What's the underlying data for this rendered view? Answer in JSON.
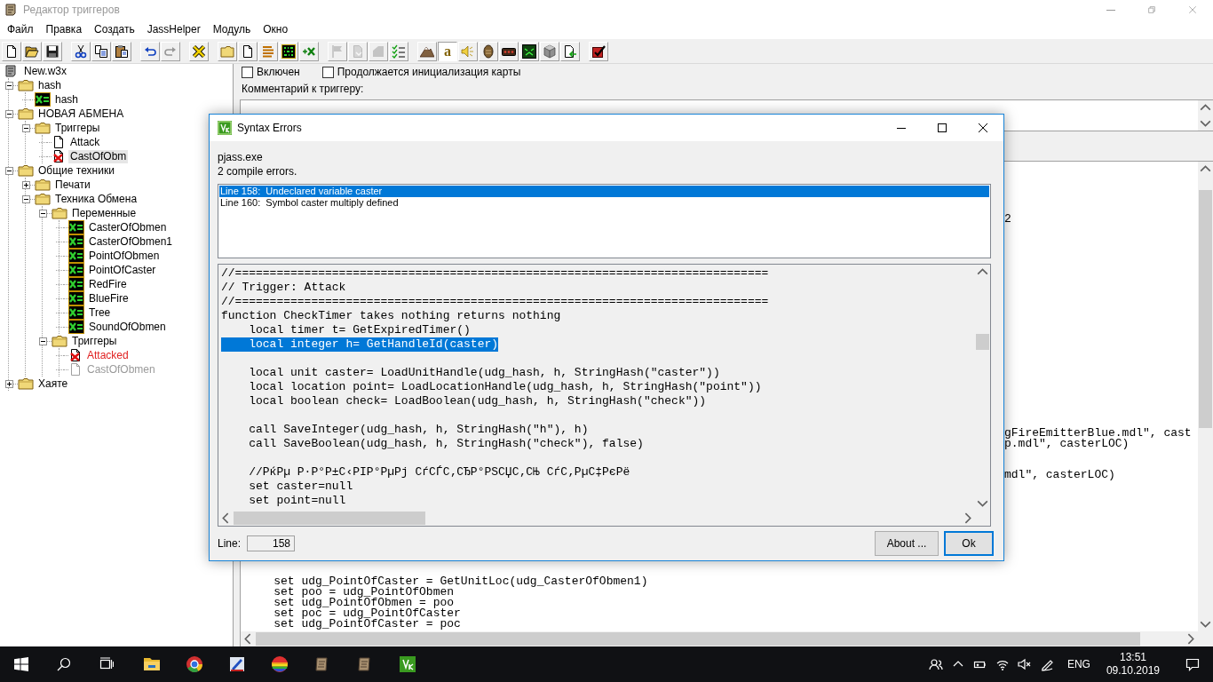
{
  "window": {
    "title": "Редактор триггеров"
  },
  "menu": [
    "Файл",
    "Правка",
    "Создать",
    "JassHelper",
    "Модуль",
    "Окно"
  ],
  "toolbar": [
    [
      {
        "kind": "new",
        "disabled": false,
        "selected": false
      },
      {
        "kind": "open",
        "disabled": false,
        "selected": false
      },
      {
        "kind": "save",
        "disabled": false,
        "selected": false
      }
    ],
    [
      {
        "kind": "cut",
        "disabled": false,
        "selected": false
      },
      {
        "kind": "copy",
        "disabled": false,
        "selected": false
      },
      {
        "kind": "paste",
        "disabled": false,
        "selected": false
      }
    ],
    [
      {
        "kind": "undo",
        "disabled": false,
        "selected": false
      },
      {
        "kind": "redo",
        "disabled": true,
        "selected": false
      }
    ],
    [
      {
        "kind": "delete",
        "disabled": false,
        "selected": false
      }
    ],
    [
      {
        "kind": "category",
        "disabled": false,
        "selected": false
      },
      {
        "kind": "trigger",
        "disabled": false,
        "selected": false
      },
      {
        "kind": "comment",
        "disabled": false,
        "selected": false
      },
      {
        "kind": "variables",
        "disabled": false,
        "selected": false
      },
      {
        "kind": "new-variable",
        "disabled": false,
        "selected": false
      }
    ],
    [
      {
        "kind": "flag",
        "disabled": true,
        "selected": false
      },
      {
        "kind": "convert",
        "disabled": true,
        "selected": false
      },
      {
        "kind": "pie",
        "disabled": true,
        "selected": false
      },
      {
        "kind": "checklist",
        "disabled": false,
        "selected": false
      }
    ],
    [
      {
        "kind": "terrain",
        "disabled": false,
        "selected": false
      },
      {
        "kind": "object",
        "glyph": "a",
        "disabled": false,
        "selected": true
      },
      {
        "kind": "sound",
        "disabled": false,
        "selected": false
      },
      {
        "kind": "model",
        "disabled": false,
        "selected": false
      },
      {
        "kind": "ui",
        "disabled": false,
        "selected": false
      },
      {
        "kind": "ai",
        "disabled": false,
        "selected": false
      },
      {
        "kind": "import",
        "disabled": false,
        "selected": false
      },
      {
        "kind": "import-doc",
        "disabled": false,
        "selected": false
      }
    ],
    [
      {
        "kind": "test",
        "disabled": false,
        "selected": false
      }
    ]
  ],
  "tree": [
    {
      "label": "New.w3x",
      "kind": "map",
      "selected": false,
      "children": [
        {
          "label": "hash",
          "kind": "folder",
          "expanded": true,
          "selected": false,
          "children": [
            {
              "label": "hash",
              "kind": "variable",
              "selected": false
            }
          ]
        },
        {
          "label": "НОВАЯ АБМЕНА",
          "kind": "folder",
          "expanded": true,
          "selected": false,
          "children": [
            {
              "label": "Триггеры",
              "kind": "folder",
              "expanded": true,
              "selected": false,
              "children": [
                {
                  "label": "Attack",
                  "kind": "trigger",
                  "selected": false,
                  "error": false,
                  "disabled": false,
                  "failed": false
                },
                {
                  "label": "CastOfObm",
                  "kind": "trigger",
                  "selected": true,
                  "error": true,
                  "disabled": false,
                  "failed": false
                }
              ]
            }
          ]
        },
        {
          "label": "Общие техники",
          "kind": "folder",
          "expanded": true,
          "selected": false,
          "children": [
            {
              "label": "Печати",
              "kind": "folder",
              "expanded": false,
              "selected": false
            },
            {
              "label": "Техника Обмена",
              "kind": "folder",
              "expanded": true,
              "selected": false,
              "children": [
                {
                  "label": "Переменные",
                  "kind": "folder",
                  "expanded": true,
                  "selected": false,
                  "children": [
                    {
                      "label": "CasterOfObmen",
                      "kind": "variable",
                      "selected": false
                    },
                    {
                      "label": "CasterOfObmen1",
                      "kind": "variable",
                      "selected": false
                    },
                    {
                      "label": "PointOfObmen",
                      "kind": "variable",
                      "selected": false
                    },
                    {
                      "label": "PointOfCaster",
                      "kind": "variable",
                      "selected": false
                    },
                    {
                      "label": "RedFire",
                      "kind": "variable",
                      "selected": false
                    },
                    {
                      "label": "BlueFire",
                      "kind": "variable",
                      "selected": false
                    },
                    {
                      "label": "Tree",
                      "kind": "variable",
                      "selected": false
                    },
                    {
                      "label": "SoundOfObmen",
                      "kind": "variable",
                      "selected": false
                    }
                  ]
                },
                {
                  "label": "Триггеры",
                  "kind": "folder",
                  "expanded": true,
                  "selected": false,
                  "children": [
                    {
                      "label": "Attacked",
                      "kind": "trigger",
                      "selected": false,
                      "error": true,
                      "disabled": false,
                      "failed": true
                    },
                    {
                      "label": "CastOfObmen",
                      "kind": "trigger",
                      "selected": false,
                      "error": false,
                      "disabled": true,
                      "failed": false
                    }
                  ]
                }
              ]
            }
          ]
        },
        {
          "label": "Хаяте",
          "kind": "folder",
          "expanded": false,
          "selected": false
        }
      ]
    }
  ],
  "trigger_panel": {
    "checkboxes": [
      {
        "label": "Включен",
        "checked": false
      },
      {
        "label": "Продолжается инициализация карты",
        "checked": false
      }
    ],
    "comment": {
      "label": "Комментарий к триггеру:"
    },
    "code": {
      "blocks": [
        {
          "kind": "fragment",
          "lines": [
            "2"
          ]
        },
        {
          "kind": "fragment",
          "lines": [
            "gFireEmitterBlue.mdl\", cast",
            "p.mdl\", casterLOC)"
          ]
        },
        {
          "kind": "fragment",
          "lines": [
            "mdl\", casterLOC)"
          ]
        },
        {
          "kind": "code",
          "lines": [
            "    set udg_PointOfCaster = GetUnitLoc(udg_CasterOfObmen1)",
            "    set poo = udg_PointOfObmen",
            "    set udg_PointOfObmen = poo",
            "    set poc = udg_PointOfCaster",
            "    set udg_PointOfCaster = poc"
          ]
        }
      ]
    }
  },
  "dialog": {
    "title": "Syntax Errors",
    "tool": "pjass.exe",
    "summary": "2 compile errors.",
    "errors": [
      {
        "text": "Line 158:  Undeclared variable caster",
        "selected": true
      },
      {
        "text": "Line 160:  Symbol caster multiply defined",
        "selected": false
      }
    ],
    "code": [
      [
        {
          "text": "//=============================================================================",
          "selected": false
        },
        {
          "text": "// Trigger: Attack",
          "selected": false
        },
        {
          "text": "//=============================================================================",
          "selected": false
        },
        {
          "text": "function CheckTimer takes nothing returns nothing",
          "selected": false
        },
        {
          "text": "    local timer t= GetExpiredTimer()",
          "selected": false
        },
        {
          "text": "    local integer h= GetHandleId(caster)",
          "selected": true
        }
      ],
      [
        {
          "text": "    local unit caster= LoadUnitHandle(udg_hash, h, StringHash(\"caster\"))",
          "selected": false
        },
        {
          "text": "    local location point= LoadLocationHandle(udg_hash, h, StringHash(\"point\"))",
          "selected": false
        },
        {
          "text": "    local boolean check= LoadBoolean(udg_hash, h, StringHash(\"check\"))",
          "selected": false
        }
      ],
      [
        {
          "text": "    call SaveInteger(udg_hash, h, StringHash(\"h\"), h)",
          "selected": false
        },
        {
          "text": "    call SaveBoolean(udg_hash, h, StringHash(\"check\"), false)",
          "selected": false
        }
      ],
      [
        {
          "text": "    //РќРµ Р·Р°Р±С‹РІР°РµРј СѓСЃС‚СЂР°РЅСЏС‚СЊ СѓС‚РµС‡РєРё",
          "selected": false
        },
        {
          "text": "    set caster=null",
          "selected": false
        },
        {
          "text": "    set point=null",
          "selected": false
        }
      ]
    ],
    "line_label": "Line:",
    "line_value": "158",
    "buttons": [
      "About ...",
      "Ok"
    ]
  },
  "taskbar": {
    "language": "ENG",
    "time": "13:51",
    "date": "09.10.2019"
  }
}
